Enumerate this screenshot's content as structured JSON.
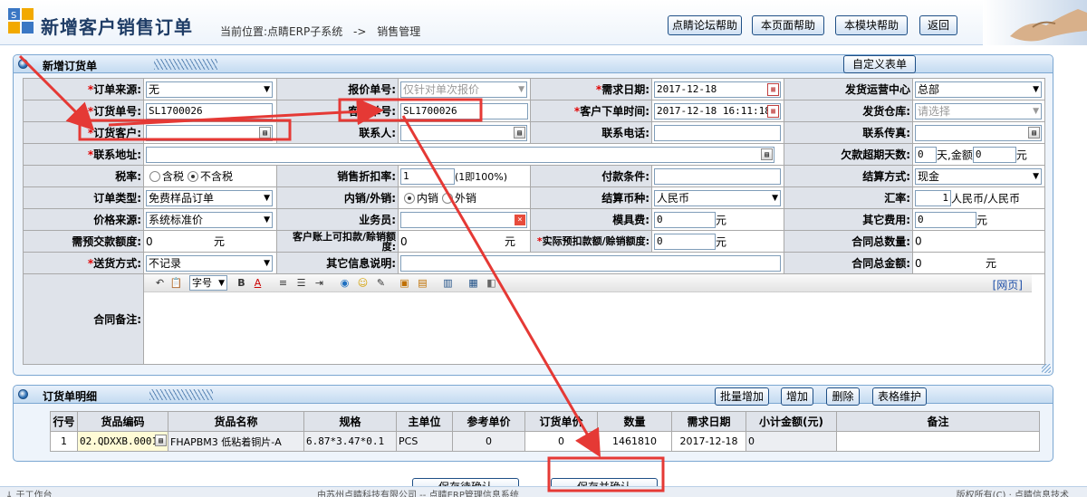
{
  "header": {
    "title": "新增客户销售订单",
    "breadcrumb_prefix": "当前位置:",
    "breadcrumb_system": "点睛ERP子系统",
    "breadcrumb_sep": "->",
    "breadcrumb_module": "销售管理",
    "buttons": [
      "点睛论坛帮助",
      "本页面帮助",
      "本模块帮助",
      "返回"
    ]
  },
  "order_panel": {
    "title": "新增订货单",
    "custom_form_button": "自定义表单"
  },
  "form": {
    "order_source": {
      "label": "订单来源:",
      "value": "无"
    },
    "quote_no": {
      "label": "报价单号:",
      "placeholder": "仅针对单次报价"
    },
    "required_date": {
      "label": "需求日期:",
      "value": "2017-12-18"
    },
    "ship_center": {
      "label": "发货运营中心",
      "value": "总部"
    },
    "order_no": {
      "label": "订货单号:",
      "value": "SL1700026"
    },
    "customer_order_no": {
      "label": "客户单号:",
      "value": "SL1700026"
    },
    "customer_order_time": {
      "label": "客户下单时间:",
      "value": "2017-12-18 16:11:18"
    },
    "ship_warehouse": {
      "label": "发货仓库:",
      "placeholder": "请选择"
    },
    "customer": {
      "label": "订货客户:",
      "value": ""
    },
    "contact": {
      "label": "联系人:",
      "value": ""
    },
    "phone": {
      "label": "联系电话:",
      "value": ""
    },
    "fax": {
      "label": "联系传真:",
      "value": ""
    },
    "address": {
      "label": "联系地址:",
      "value": ""
    },
    "overdue_days": {
      "label": "欠款超期天数:",
      "days": "0",
      "days_unit": "天,金额",
      "amount": "0",
      "amount_unit": "元"
    },
    "tax_rate": {
      "label": "税率:",
      "opt1": "含税",
      "opt2": "不含税"
    },
    "discount": {
      "label": "销售折扣率:",
      "value": "1",
      "hint": "(1即100%)"
    },
    "payment_terms": {
      "label": "付款条件:",
      "value": ""
    },
    "settlement": {
      "label": "结算方式:",
      "value": "现金"
    },
    "order_type": {
      "label": "订单类型:",
      "value": "免费样品订单"
    },
    "domestic": {
      "label": "内销/外销:",
      "opt1": "内销",
      "opt2": "外销"
    },
    "currency": {
      "label": "结算币种:",
      "value": "人民币"
    },
    "exchange_rate": {
      "label": "汇率:",
      "value": "1",
      "unit": "人民币/人民币"
    },
    "price_source": {
      "label": "价格来源:",
      "value": "系统标准价"
    },
    "salesman": {
      "label": "业务员:",
      "value": ""
    },
    "mold_fee": {
      "label": "模具费:",
      "value": "0",
      "unit": "元"
    },
    "other_fee": {
      "label": "其它费用:",
      "value": "0",
      "unit": "元"
    },
    "prepay": {
      "label": "需预交款额度:",
      "value": "0",
      "unit": "元"
    },
    "deduct_credit": {
      "label": "客户账上可扣款/赊销额度:",
      "value": "0",
      "unit": "元"
    },
    "actual_prededuct": {
      "label": "实际预扣款额/赊销额度:",
      "value": "0",
      "unit": "元"
    },
    "contract_qty": {
      "label": "合同总数量:",
      "value": "0"
    },
    "delivery_method": {
      "label": "送货方式:",
      "value": "不记录"
    },
    "other_info": {
      "label": "其它信息说明:",
      "value": ""
    },
    "contract_amount": {
      "label": "合同总金额:",
      "value": "0",
      "unit": "元"
    },
    "remarks": {
      "label": "合同备注:",
      "font_size_label": "字号",
      "web_link": "[网页]"
    }
  },
  "detail_panel": {
    "title": "订货单明细",
    "buttons": [
      "批量增加",
      "增加",
      "删除",
      "表格维护"
    ],
    "columns": [
      "行号",
      "货品编码",
      "货品名称",
      "规格",
      "主单位",
      "参考单价",
      "订货单价",
      "数量",
      "需求日期",
      "小计金额(元)",
      "备注"
    ],
    "rows": [
      {
        "line": "1",
        "code": "02.QDXXB.0001",
        "name": "FHAPBM3 低粘着铜片-A",
        "spec": "6.87*3.47*0.1",
        "unit": "PCS",
        "ref_price": "0",
        "price": "0",
        "qty": "1461810",
        "date": "2017-12-18",
        "subtotal": "0",
        "remark": ""
      }
    ]
  },
  "bottom_buttons": [
    "保存待确认",
    "保存并确认"
  ],
  "footer": {
    "left": "↓ 于工作台",
    "center": "由苏州点睛科技有限公司 -- 点睛ERP管理信息系统",
    "right": "版权所有(C) · 点睛信息技术"
  },
  "colors": {
    "accent": "#1e4f86",
    "label_bg": "#dfe3ea",
    "annotation": "#e53935"
  }
}
